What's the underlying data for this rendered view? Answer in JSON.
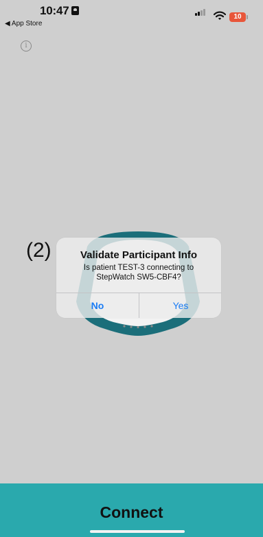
{
  "status_bar": {
    "time": "10:47",
    "back_label": "◀ App Store",
    "battery_level": "10",
    "battery_color": "#e8563a"
  },
  "info_icon": "info-icon",
  "step_label": "(2)",
  "alert": {
    "title": "Validate Participant Info",
    "message_line1": "Is patient TEST-3 connecting to",
    "message_line2": "StepWatch SW5-CBF4?",
    "no_label": "No",
    "yes_label": "Yes",
    "button_color": "#1a7cf5"
  },
  "connect_button": {
    "label": "Connect",
    "color": "#2aa9ad"
  }
}
